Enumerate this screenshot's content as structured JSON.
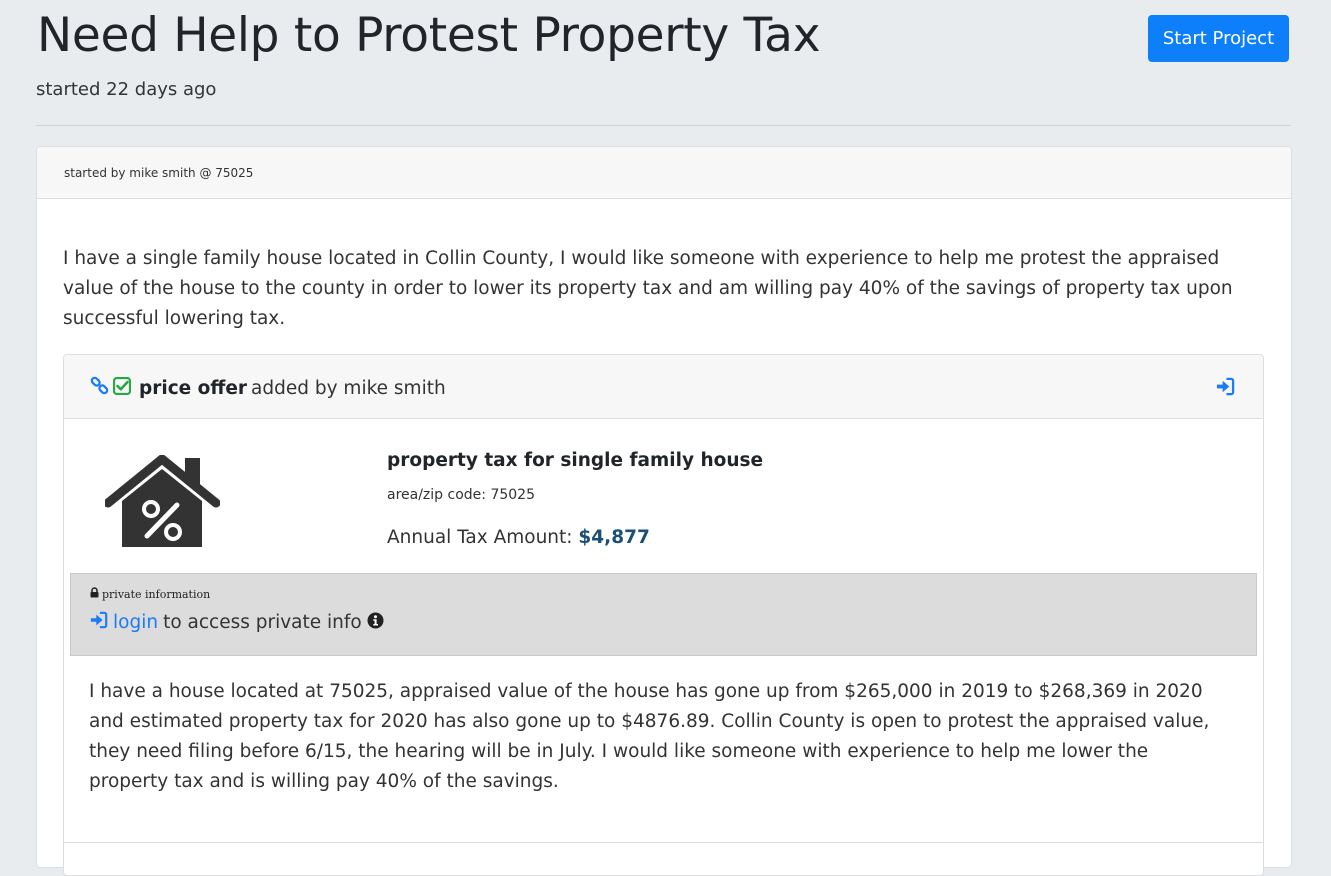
{
  "page": {
    "title": "Need Help to Protest Property Tax",
    "subtitle": "started 22 days ago",
    "start_button_label": "Start Project"
  },
  "card": {
    "meta": "started by mike smith @ 75025",
    "description": "I have a single family house located in Collin County, I would like someone with experience to help me protest the appraised value of the house to the county in order to lower its property tax and am willing pay 40% of the savings of property tax upon successful lowering tax."
  },
  "offer": {
    "type_label": "price offer",
    "added_by": "added by mike smith",
    "product_name": "property tax for single family house",
    "area": "area/zip code: 75025",
    "tax_label": "Annual Tax Amount:",
    "tax_value": "$4,877",
    "private": {
      "label": "private information",
      "login_label": "login",
      "access_text": "to access private info"
    },
    "detail": "I have a house located at 75025, appraised value of the house has gone up from $265,000 in 2019 to $268,369 in 2020 and estimated property tax for 2020 has also gone up to $4876.89. Collin County is open to protest the appraised value, they need filing before 6/15, the hearing will be in July. I would like someone with experience to help me lower the property tax and is willing pay 40% of the savings."
  },
  "icons": {
    "link": "link-icon",
    "check": "check-square-icon",
    "sign_in": "sign-in-icon",
    "lock": "lock-icon",
    "info": "info-circle-icon",
    "house": "house-percent-icon"
  },
  "colors": {
    "primary": "#0d7ffb",
    "link": "#1a7cf5",
    "check": "#28a745",
    "tax_value": "#1a4f79",
    "private_bg": "#dcdcdc"
  }
}
